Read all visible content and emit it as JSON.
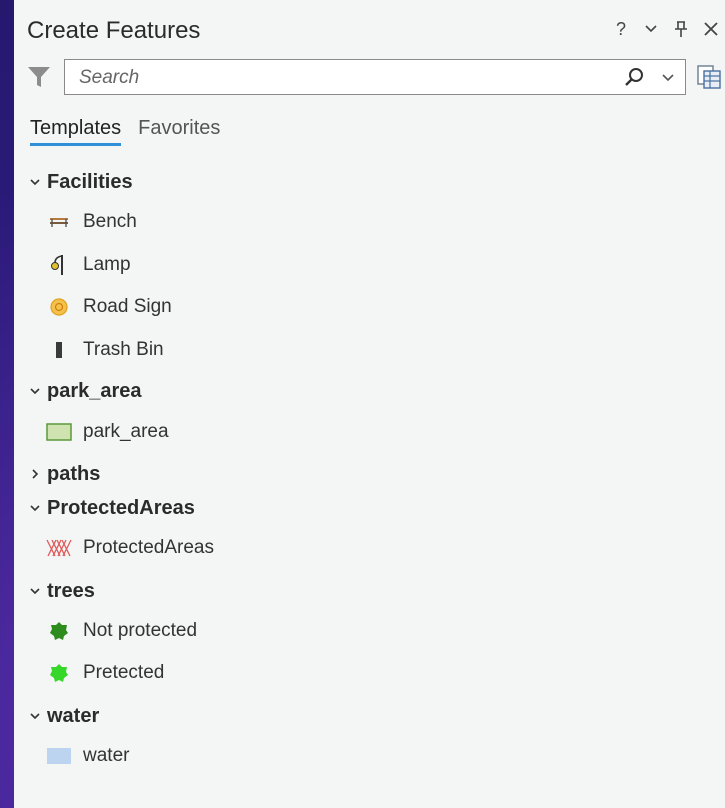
{
  "panel": {
    "title": "Create Features",
    "controls": {
      "help": "?",
      "menu": "⌄",
      "pin": "⊥",
      "close": "✕"
    }
  },
  "search": {
    "placeholder": "Search",
    "value": ""
  },
  "tabs": [
    {
      "label": "Templates",
      "active": true
    },
    {
      "label": "Favorites",
      "active": false
    }
  ],
  "groups": {
    "facilities": {
      "label": "Facilities",
      "expanded": true,
      "items": [
        {
          "label": "Bench",
          "icon": "bench-icon"
        },
        {
          "label": "Lamp",
          "icon": "lamp-icon"
        },
        {
          "label": "Road Sign",
          "icon": "road-sign-icon"
        },
        {
          "label": "Trash Bin",
          "icon": "trash-bin-icon"
        }
      ]
    },
    "park_area": {
      "label": "park_area",
      "expanded": true,
      "items": [
        {
          "label": "park_area",
          "icon": "polygon-fill-icon",
          "color": "#cfe3b0"
        }
      ]
    },
    "paths": {
      "label": "paths",
      "expanded": false,
      "items": []
    },
    "protected": {
      "label": "ProtectedAreas",
      "expanded": true,
      "items": [
        {
          "label": "ProtectedAreas",
          "icon": "hatched-polygon-icon",
          "color": "#e05a5a"
        }
      ]
    },
    "trees": {
      "label": "trees",
      "expanded": true,
      "items": [
        {
          "label": "Not protected",
          "icon": "tree-icon",
          "color": "#2e8b1e"
        },
        {
          "label": "Pretected",
          "icon": "tree-icon",
          "color": "#37d62a"
        }
      ]
    },
    "water": {
      "label": "water",
      "expanded": true,
      "items": [
        {
          "label": "water",
          "icon": "polygon-fill-icon",
          "color": "#bcd4ef"
        }
      ]
    }
  }
}
